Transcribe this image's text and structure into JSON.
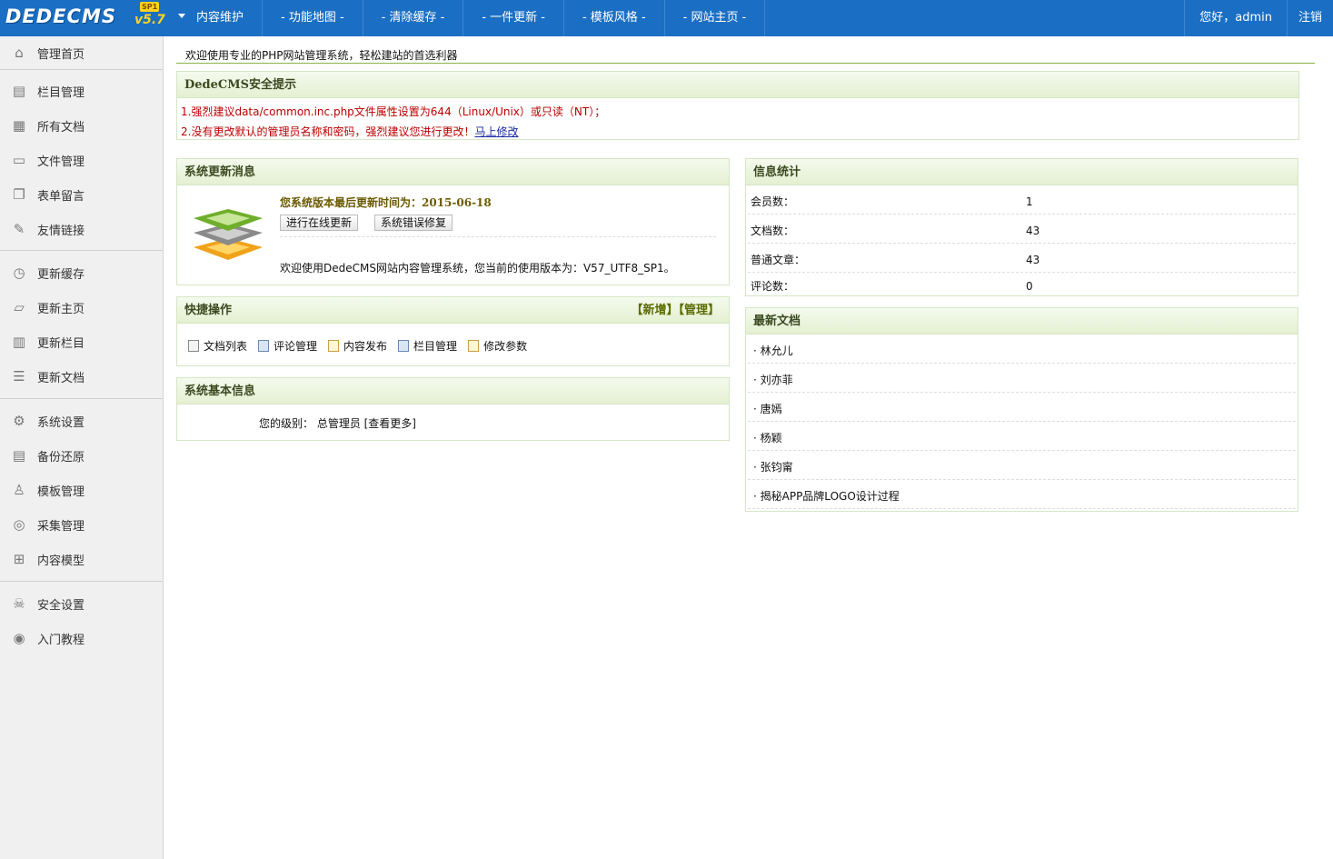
{
  "logo": {
    "brand": "DEDECMS",
    "version": "v5.7",
    "sp": "SP1"
  },
  "nav": [
    "内容维护",
    "- 功能地图 -",
    "- 清除缓存 -",
    "- 一件更新 -",
    "- 模板风格 -",
    "- 网站主页 -"
  ],
  "user": {
    "greeting": "您好，admin",
    "logout": "注销"
  },
  "sidebar": {
    "g1": [
      {
        "label": "管理首页",
        "icon": "home-icon"
      }
    ],
    "g2": [
      {
        "label": "栏目管理",
        "icon": "columns-icon"
      },
      {
        "label": "所有文档",
        "icon": "documents-icon"
      },
      {
        "label": "文件管理",
        "icon": "monitor-icon"
      },
      {
        "label": "表单留言",
        "icon": "copy-icon"
      },
      {
        "label": "友情链接",
        "icon": "link-icon"
      }
    ],
    "g3": [
      {
        "label": "更新缓存",
        "icon": "clock-icon"
      },
      {
        "label": "更新主页",
        "icon": "folder-icon"
      },
      {
        "label": "更新栏目",
        "icon": "calendar-icon"
      },
      {
        "label": "更新文档",
        "icon": "list-icon"
      }
    ],
    "g4": [
      {
        "label": "系统设置",
        "icon": "gear-icon"
      },
      {
        "label": "备份还原",
        "icon": "database-icon"
      },
      {
        "label": "模板管理",
        "icon": "user-icon"
      },
      {
        "label": "采集管理",
        "icon": "collect-icon"
      },
      {
        "label": "内容模型",
        "icon": "sitemap-icon"
      }
    ],
    "g5": [
      {
        "label": "安全设置",
        "icon": "skull-icon"
      },
      {
        "label": "入门教程",
        "icon": "disc-icon"
      }
    ]
  },
  "welcome": "欢迎使用专业的PHP网站管理系统，轻松建站的首选利器",
  "security": {
    "title": "DedeCMS安全提示",
    "line1": "1.强烈建议data/common.inc.php文件属性设置为644（Linux/Unix）或只读（NT）；",
    "line2": "2.没有更改默认的管理员名称和密码，强烈建议您进行更改！",
    "line2_link": "马上修改"
  },
  "update": {
    "title": "系统更新消息",
    "last_update": "您系统版本最后更新时间为：2015-06-18",
    "btn_online": "进行在线更新",
    "btn_fix": "系统错误修复",
    "info": "欢迎使用DedeCMS网站内容管理系统，您当前的使用版本为：V57_UTF8_SP1。"
  },
  "quick": {
    "title": "快捷操作",
    "links": "【新增】【管理】",
    "items": [
      "文档列表",
      "评论管理",
      "内容发布",
      "栏目管理",
      "修改参数"
    ]
  },
  "basic": {
    "title": "系统基本信息",
    "text": "您的级别：  总管理员 [查看更多]"
  },
  "stats": {
    "title": "信息统计",
    "rows": [
      {
        "label": "会员数：",
        "value": "1"
      },
      {
        "label": "文档数：",
        "value": "43"
      },
      {
        "label": "普通文章：",
        "value": "43"
      },
      {
        "label": "评论数：",
        "value": "0"
      }
    ]
  },
  "latest": {
    "title": "最新文档",
    "items": [
      "· 林允儿",
      "· 刘亦菲",
      "· 唐嫣",
      "· 杨颖",
      "· 张钧甯",
      "· 揭秘APP品牌LOGO设计过程"
    ]
  }
}
